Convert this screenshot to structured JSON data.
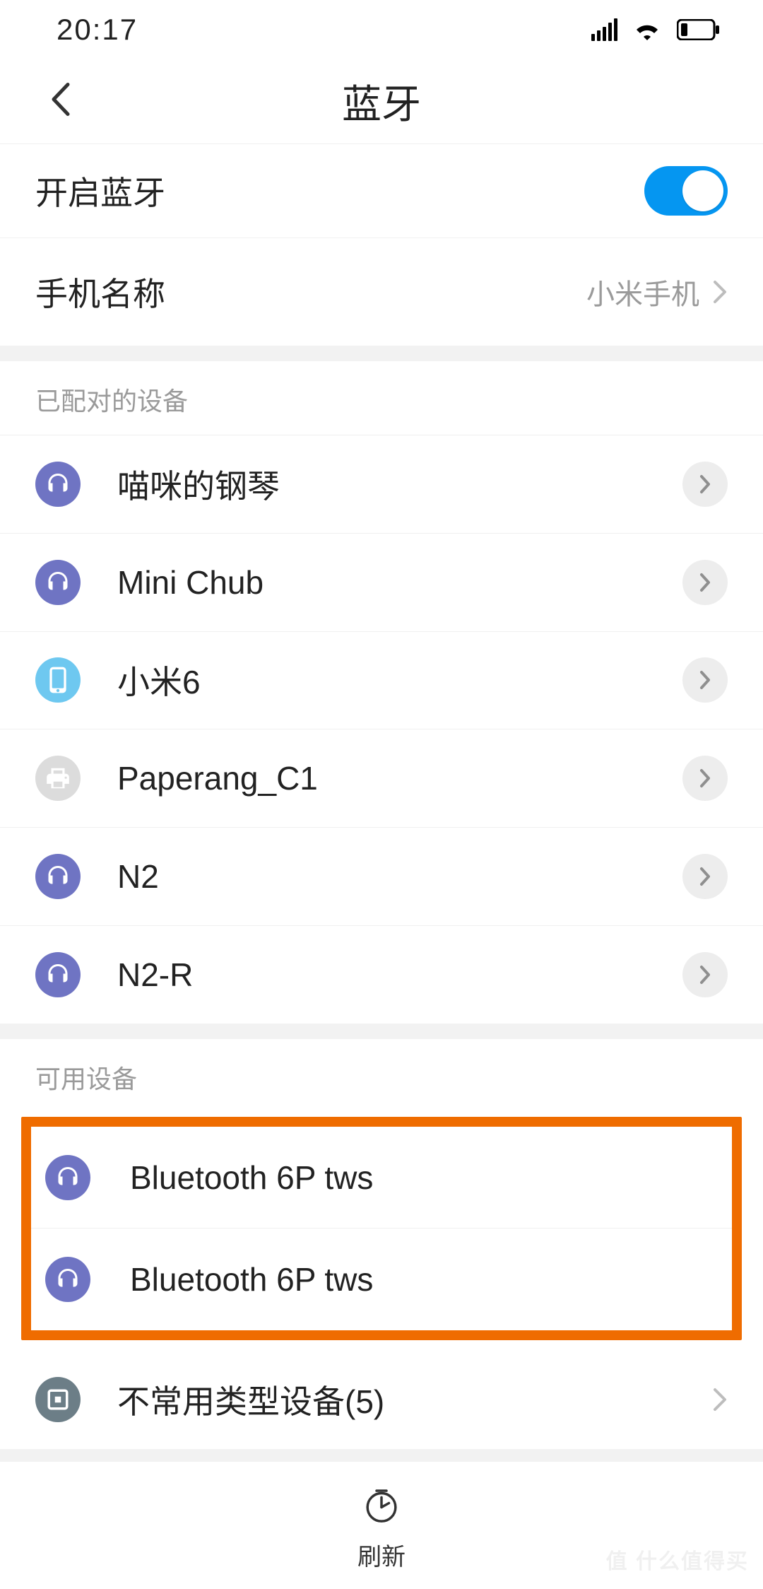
{
  "status": {
    "time": "20:17"
  },
  "header": {
    "title": "蓝牙"
  },
  "settings": {
    "bluetooth_label": "开启蓝牙",
    "bluetooth_on": true,
    "phone_name_label": "手机名称",
    "phone_name_value": "小米手机"
  },
  "sections": {
    "paired_header": "已配对的设备",
    "available_header": "可用设备"
  },
  "paired": [
    {
      "name": "喵咪的钢琴",
      "icon": "headset"
    },
    {
      "name": "Mini Chub",
      "icon": "headset"
    },
    {
      "name": "小米6",
      "icon": "phone"
    },
    {
      "name": "Paperang_C1",
      "icon": "printer"
    },
    {
      "name": "N2",
      "icon": "headset"
    },
    {
      "name": "N2-R",
      "icon": "headset"
    }
  ],
  "available": [
    {
      "name": "Bluetooth 6P tws",
      "icon": "headset"
    },
    {
      "name": "Bluetooth 6P tws",
      "icon": "headset"
    }
  ],
  "uncommon": {
    "label": "不常用类型设备(5)"
  },
  "footer": {
    "refresh_label": "刷新"
  },
  "watermark": "值 什么值得买"
}
